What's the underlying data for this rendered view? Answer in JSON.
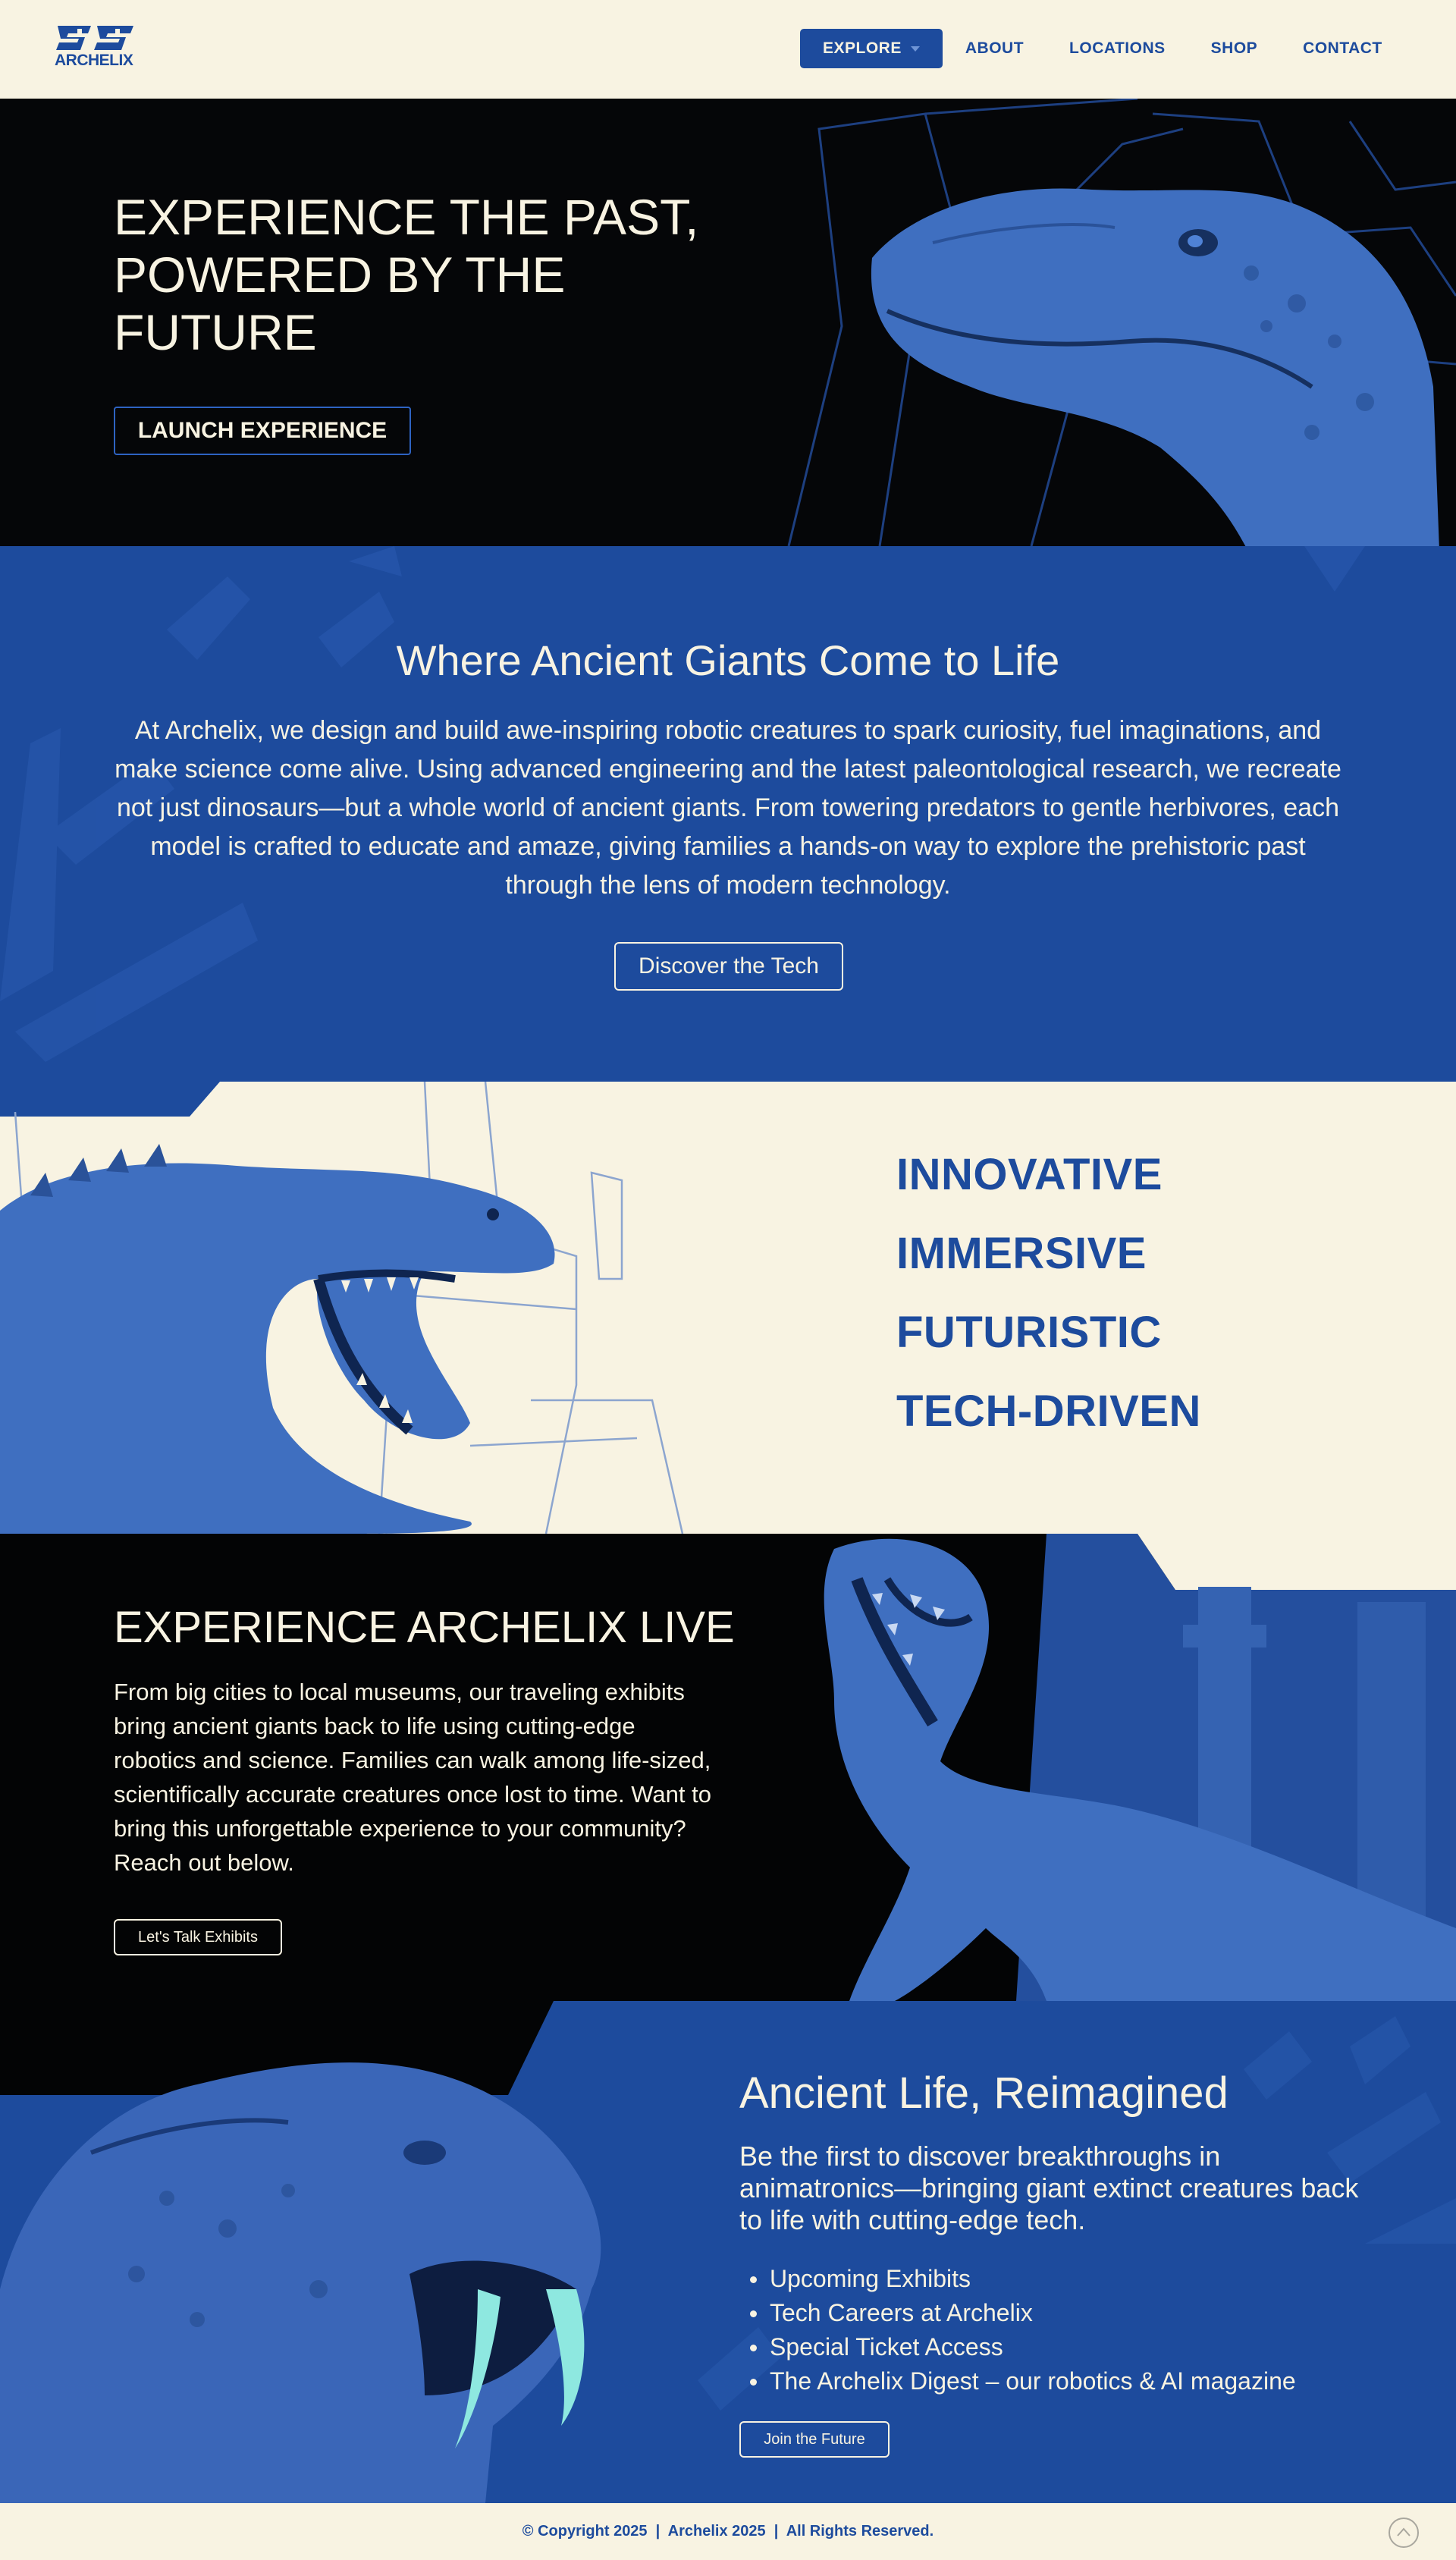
{
  "header": {
    "logo_text": "ARCHELIX",
    "nav": [
      {
        "label": "EXPLORE"
      },
      {
        "label": "ABOUT"
      },
      {
        "label": "LOCATIONS"
      },
      {
        "label": "SHOP"
      },
      {
        "label": "CONTACT"
      }
    ]
  },
  "hero": {
    "title": "EXPERIENCE THE PAST, POWERED BY THE FUTURE",
    "button_label": "LAUNCH EXPERIENCE"
  },
  "giants": {
    "title": "Where Ancient Giants Come to Life",
    "body": "At Archelix, we design and build awe-inspiring robotic creatures to spark curiosity, fuel imaginations, and make science come alive. Using advanced engineering and the latest paleontological research, we recreate not just dinosaurs—but a whole world of ancient giants. From towering predators to gentle herbivores, each model is crafted to educate and amaze, giving families a hands-on way to explore the prehistoric past through the lens of modern technology.",
    "button_label": "Discover the Tech"
  },
  "innovative": {
    "words": [
      "INNOVATIVE",
      "IMMERSIVE",
      "FUTURISTIC",
      "TECH-DRIVEN"
    ]
  },
  "live": {
    "title": "EXPERIENCE ARCHELIX LIVE",
    "body": "From big cities to local museums, our traveling exhibits bring ancient giants back to life using cutting-edge robotics and science. Families can walk among life-sized, scientifically accurate creatures once lost to time. Want to bring this unforgettable experience to your community? Reach out below.",
    "button_label": "Let's Talk Exhibits"
  },
  "reimagined": {
    "title": "Ancient Life, Reimagined",
    "body": "Be the first to discover breakthroughs in animatronics—bringing giant extinct creatures back to life with cutting-edge tech.",
    "items": [
      "Upcoming Exhibits",
      "Tech Careers at Archelix",
      "Special Ticket Access",
      "The Archelix Digest – our robotics & AI magazine"
    ],
    "button_label": "Join the Future"
  },
  "footer": {
    "text": "© Copyright 2025  |  Archelix 2025  |  All Rights Reserved."
  },
  "colors": {
    "cream": "#f8f3e2",
    "brand_blue": "#1d4b9d",
    "dino_blue": "#3f6fc0",
    "dark": "#050608"
  },
  "icons": [
    "archelix-logo",
    "chevron-down-icon",
    "scroll-to-top-icon"
  ]
}
